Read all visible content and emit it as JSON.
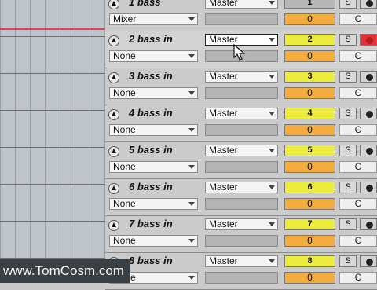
{
  "colors": {
    "arm_on": "#ecec3e",
    "send_level": "#f3ad3e",
    "record_armed": "#e0303a",
    "clip_line": "#e0405a"
  },
  "tracks": [
    {
      "name": "1 bass",
      "input": "Mixer",
      "output": "Master",
      "number": "1",
      "send": "0",
      "cue": "C",
      "solo": "S",
      "selected": false,
      "armed": false
    },
    {
      "name": "2 bass in",
      "input": "None",
      "output": "Master",
      "number": "2",
      "send": "0",
      "cue": "C",
      "solo": "S",
      "selected": true,
      "armed": true
    },
    {
      "name": "3 bass in",
      "input": "None",
      "output": "Master",
      "number": "3",
      "send": "0",
      "cue": "C",
      "solo": "S",
      "selected": false,
      "armed": false
    },
    {
      "name": "4 bass in",
      "input": "None",
      "output": "Master",
      "number": "4",
      "send": "0",
      "cue": "C",
      "solo": "S",
      "selected": false,
      "armed": false
    },
    {
      "name": "5 bass in",
      "input": "None",
      "output": "Master",
      "number": "5",
      "send": "0",
      "cue": "C",
      "solo": "S",
      "selected": false,
      "armed": false
    },
    {
      "name": "6 bass in",
      "input": "None",
      "output": "Master",
      "number": "6",
      "send": "0",
      "cue": "C",
      "solo": "S",
      "selected": false,
      "armed": false
    },
    {
      "name": "7 bass in",
      "input": "None",
      "output": "Master",
      "number": "7",
      "send": "0",
      "cue": "C",
      "solo": "S",
      "selected": false,
      "armed": false
    },
    {
      "name": "8 bass in",
      "input": "None",
      "output": "Master",
      "number": "8",
      "send": "0",
      "cue": "C",
      "solo": "S",
      "selected": false,
      "armed": false
    }
  ],
  "icons": {
    "fold": "triangle-up-icon",
    "dropdown": "chevron-down-icon",
    "record": "record-dot-icon",
    "cursor": "mouse-pointer-icon"
  },
  "watermark": "www.TomCosm.com"
}
